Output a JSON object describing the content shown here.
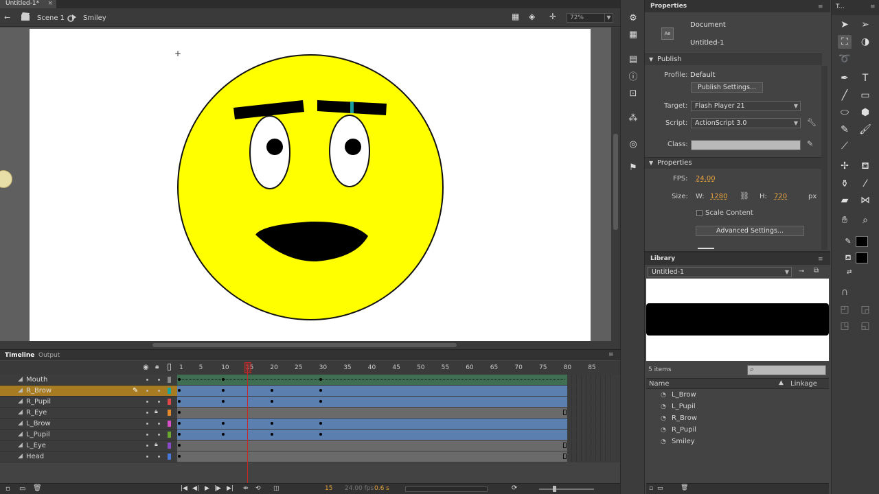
{
  "doc_tab": {
    "title": "Untitled-1*",
    "close": "×"
  },
  "edit_bar": {
    "scene": "Scene 1",
    "symbol": "Smiley",
    "zoom": "72%"
  },
  "timeline": {
    "tabs": [
      "Timeline",
      "Output"
    ],
    "frame_numbers": [
      "1",
      "5",
      "10",
      "15",
      "20",
      "25",
      "30",
      "35",
      "40",
      "45",
      "50",
      "55",
      "60",
      "65",
      "70",
      "75",
      "80",
      "85"
    ],
    "layers": [
      {
        "name": "Mouth",
        "locked": false,
        "color": "#888888",
        "keyframes": [
          1,
          10,
          30
        ],
        "type": "motion"
      },
      {
        "name": "R_Brow",
        "locked": false,
        "color": "#1aa39a",
        "keyframes": [
          1,
          10,
          20,
          30
        ],
        "selected": true
      },
      {
        "name": "R_Pupil",
        "locked": false,
        "color": "#e04848",
        "keyframes": [
          1,
          10,
          20,
          30
        ]
      },
      {
        "name": "R_Eye",
        "locked": true,
        "color": "#e58a2a",
        "keyframes": [
          1
        ]
      },
      {
        "name": "L_Brow",
        "locked": false,
        "color": "#d850c8",
        "keyframes": [
          1,
          10,
          20,
          30
        ]
      },
      {
        "name": "L_Pupil",
        "locked": false,
        "color": "#6aa830",
        "keyframes": [
          1,
          10,
          20,
          30
        ]
      },
      {
        "name": "L_Eye",
        "locked": true,
        "color": "#8a4ac8",
        "keyframes": [
          1
        ]
      },
      {
        "name": "Head",
        "locked": false,
        "color": "#4a78d8",
        "keyframes": [
          1
        ]
      }
    ],
    "current_frame": "15",
    "fps": "24.00 fps",
    "time": "0.6 s"
  },
  "properties": {
    "panel_title": "Properties",
    "doc_type": "Document",
    "doc_name": "Untitled-1",
    "publish_section": "Publish",
    "profile_label": "Profile:",
    "profile_value": "Default",
    "publish_settings": "Publish Settings...",
    "target_label": "Target:",
    "target_value": "Flash Player 21",
    "script_label": "Script:",
    "script_value": "ActionScript 3.0",
    "class_label": "Class:",
    "properties_section": "Properties",
    "fps_label": "FPS:",
    "fps_value": "24.00",
    "size_label": "Size:",
    "w_label": "W:",
    "w_value": "1280",
    "h_label": "H:",
    "h_value": "720",
    "unit": "px",
    "scale_content": "Scale Content",
    "advanced_settings": "Advanced Settings..."
  },
  "library": {
    "panel_title": "Library",
    "doc_select": "Untitled-1",
    "count": "5 items",
    "col_name": "Name",
    "col_linkage": "Linkage",
    "items": [
      "L_Brow",
      "L_Pupil",
      "R_Brow",
      "R_Pupil",
      "Smiley"
    ]
  },
  "tools": {
    "title": "T..."
  },
  "colors": {
    "stage": "#ffffff",
    "face": "#ffff00",
    "accent_selected": "#a77b22",
    "playhead": "#c62828"
  }
}
